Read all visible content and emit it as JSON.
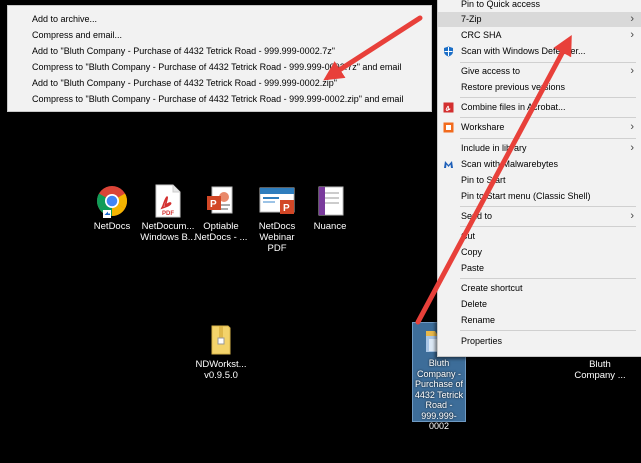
{
  "submenu": {
    "items": [
      "Add to archive...",
      "Compress and email...",
      "Add to \"Bluth Company - Purchase of 4432 Tetrick Road - 999.999-0002.7z\"",
      "Compress to \"Bluth Company - Purchase of 4432 Tetrick Road - 999.999-0002.7z\" and email",
      "Add to \"Bluth Company - Purchase of 4432 Tetrick Road - 999.999-0002.zip\"",
      "Compress to \"Bluth Company - Purchase of 4432 Tetrick Road - 999.999-0002.zip\" and email"
    ]
  },
  "context_menu": {
    "items": [
      {
        "label": "Pin to Quick access",
        "icon": "",
        "submenu": false
      },
      {
        "label": "7-Zip",
        "icon": "",
        "submenu": true,
        "highlighted": true
      },
      {
        "label": "CRC SHA",
        "icon": "",
        "submenu": true
      },
      {
        "label": "Scan with Windows Defender...",
        "icon": "defender-icon",
        "submenu": false
      },
      {
        "label": "Give access to",
        "icon": "",
        "submenu": true
      },
      {
        "label": "Restore previous versions",
        "icon": "",
        "submenu": false
      },
      {
        "label": "Combine files in Acrobat...",
        "icon": "acrobat-icon",
        "submenu": false
      },
      {
        "label": "Workshare",
        "icon": "workshare-icon",
        "submenu": true
      },
      {
        "label": "Include in library",
        "icon": "",
        "submenu": true
      },
      {
        "label": "Scan with Malwarebytes",
        "icon": "malwarebytes-icon",
        "submenu": false
      },
      {
        "label": "Pin to Start",
        "icon": "",
        "submenu": false
      },
      {
        "label": "Pin to Start menu (Classic Shell)",
        "icon": "",
        "submenu": false
      },
      {
        "label": "Send to",
        "icon": "",
        "submenu": true
      },
      {
        "label": "Cut",
        "icon": "",
        "submenu": false
      },
      {
        "label": "Copy",
        "icon": "",
        "submenu": false
      },
      {
        "label": "Paste",
        "icon": "",
        "submenu": false
      },
      {
        "label": "Create shortcut",
        "icon": "",
        "submenu": false
      },
      {
        "label": "Delete",
        "icon": "",
        "submenu": false
      },
      {
        "label": "Rename",
        "icon": "",
        "submenu": false
      },
      {
        "label": "Properties",
        "icon": "",
        "submenu": false
      }
    ]
  },
  "desktop": {
    "icons": [
      {
        "label": "NetDocs",
        "icon": "chrome-icon"
      },
      {
        "label": "NetDocum... Windows B...",
        "icon": "pdf-icon"
      },
      {
        "label": "Optiable NetDocs - ...",
        "icon": "powerpoint-icon"
      },
      {
        "label": "NetDocs Webinar PDF",
        "icon": "powerpoint-icon"
      },
      {
        "label": "Nuance",
        "icon": "onenote-icon"
      },
      {
        "label": "NDWorkst... v0.9.5.0",
        "icon": "zip-folder-icon"
      },
      {
        "label": "Bluth Company - Purchase of 4432 Tetrick Road - 999.999-0002",
        "icon": "folder-icon",
        "selected": true
      },
      {
        "label": "Bluth Company ...",
        "icon": "folder-icon"
      }
    ]
  },
  "colors": {
    "arrow": "#e8403a",
    "menu_bg": "#f2f2f2",
    "highlight": "#d9d9d9",
    "selection": "#3d6d99"
  }
}
